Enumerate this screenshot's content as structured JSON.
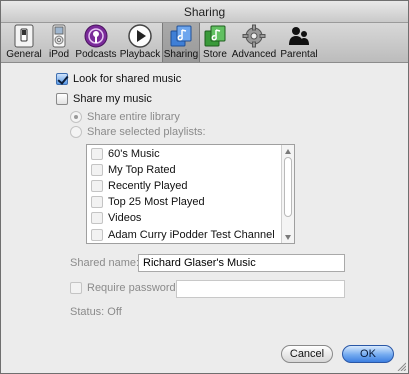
{
  "window": {
    "title": "Sharing"
  },
  "toolbar": {
    "items": [
      {
        "label": "General",
        "icon": "general-switch-icon"
      },
      {
        "label": "iPod",
        "icon": "ipod-icon"
      },
      {
        "label": "Podcasts",
        "icon": "podcast-icon"
      },
      {
        "label": "Playback",
        "icon": "play-icon"
      },
      {
        "label": "Sharing",
        "icon": "sharing-icon",
        "selected": true
      },
      {
        "label": "Store",
        "icon": "store-icon"
      },
      {
        "label": "Advanced",
        "icon": "gear-icon"
      },
      {
        "label": "Parental",
        "icon": "parental-icon"
      }
    ]
  },
  "sharing": {
    "look_for_shared": {
      "label": "Look for shared music",
      "checked": true
    },
    "share_my_music": {
      "label": "Share my music",
      "checked": false
    },
    "share_entire": "Share entire library",
    "share_selected": "Share selected playlists:",
    "playlists": [
      "60's Music",
      "My Top Rated",
      "Recently Played",
      "Top 25 Most Played",
      "Videos",
      "Adam Curry iPodder Test Channel"
    ],
    "shared_name_label": "Shared name:",
    "shared_name_value": "Richard Glaser's Music",
    "require_password_label": "Require password:",
    "password_value": "",
    "status": "Status: Off"
  },
  "buttons": {
    "cancel": "Cancel",
    "ok": "OK"
  },
  "colors": {
    "ok_button": "#4a86e8",
    "selected_tab": "#9f9f9f",
    "checkbox_checked": "#5b9be8"
  }
}
